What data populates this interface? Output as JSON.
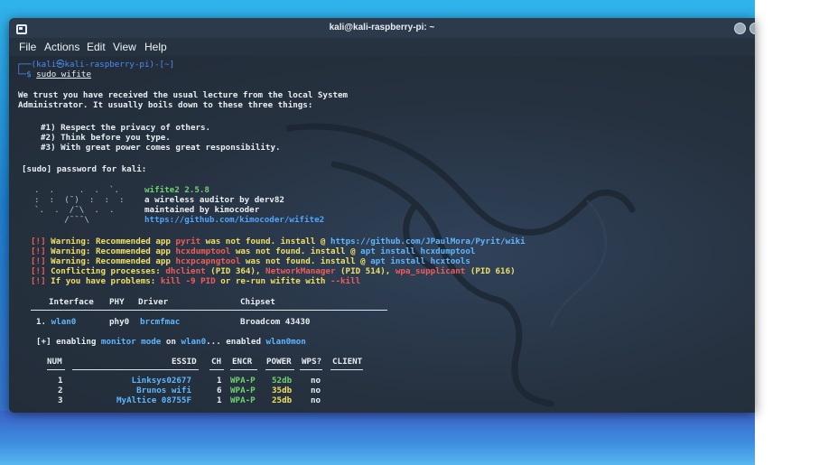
{
  "window": {
    "title": "kali@kali-raspberry-pi: ~"
  },
  "menu": {
    "items": [
      "File",
      "Actions",
      "Edit",
      "View",
      "Help"
    ]
  },
  "prompt": {
    "line1": "┌──(kali㉿kali-raspberry-pi)-[~]",
    "line2_prefix": "└─$ ",
    "command": "sudo wifite"
  },
  "lecture": {
    "l1": "We trust you have received the usual lecture from the local System",
    "l2": "Administrator. It usually boils down to these three things:",
    "r1": "#1) Respect the privacy of others.",
    "r2": "#2) Think before you type.",
    "r3": "#3) With great power comes great responsibility.",
    "password": "[sudo] password for kali:"
  },
  "banner": {
    "art1": ".  .     .  .  `.",
    "art2": ":  :  (¯)  :  :  :",
    "art3": "`.  .  /¯\\  .  .",
    "art4": "      /¯¯¯\\",
    "name": "wifite2 2.5.8",
    "desc": "a wireless auditor by derv82",
    "maint": "maintained by kimocoder",
    "url": "https://github.com/kimocoder/wifite2"
  },
  "warnings": [
    {
      "mark": "[!]",
      "label": "Warning:",
      "pre": " Recommended app ",
      "app": "pyrit",
      "post": " was not found. install @ ",
      "link": "https://github.com/JPaulMora/Pyrit/wiki"
    },
    {
      "mark": "[!]",
      "label": "Warning:",
      "pre": " Recommended app ",
      "app": "hcxdumptool",
      "post": " was not found. install @ ",
      "link": "apt install hcxdumptool"
    },
    {
      "mark": "[!]",
      "label": "Warning:",
      "pre": " Recommended app ",
      "app": "hcxpcapngtool",
      "post": " was not found. install @ ",
      "link": "apt install hcxtools"
    }
  ],
  "conflict": {
    "mark": "[!]",
    "text": " Conflicting processes: ",
    "p1": "dhclient",
    "p1pid": " (PID 364), ",
    "p2": "NetworkManager",
    "p2pid": " (PID 514), ",
    "p3": "wpa_supplicant",
    "p3pid": " (PID 616)"
  },
  "problems": {
    "mark": "[!]",
    "text": " If you have problems: ",
    "cmd": "kill -9 PID",
    "mid": " or re-run wifite with ",
    "flag": "--kill"
  },
  "iface_table": {
    "headers": [
      "Interface",
      "PHY",
      "Driver",
      "Chipset"
    ],
    "row": {
      "num": "1.",
      "iface": "wlan0",
      "phy": "phy0",
      "driver": "brcmfmac",
      "chipset": "Broadcom 43430"
    }
  },
  "monitor": {
    "prefix": "[+] enabling ",
    "mode": "monitor mode",
    "on": " on ",
    "iface": "wlan0",
    "dots": "... enabled ",
    "mon": "wlan0mon"
  },
  "scan_table": {
    "headers": [
      "NUM",
      "ESSID",
      "CH",
      "ENCR",
      "POWER",
      "WPS?",
      "CLIENT"
    ],
    "rows": [
      {
        "num": "1",
        "essid": "Linksys02677",
        "ch": "1",
        "encr": "WPA-P",
        "power": "52db",
        "wps": "no"
      },
      {
        "num": "2",
        "essid": "Brunos wifi",
        "ch": "6",
        "encr": "WPA-P",
        "power": "35db",
        "wps": "no"
      },
      {
        "num": "3",
        "essid": "MyAltice 08755F",
        "ch": "1",
        "encr": "WPA-P",
        "power": "25db",
        "wps": "no"
      }
    ]
  }
}
